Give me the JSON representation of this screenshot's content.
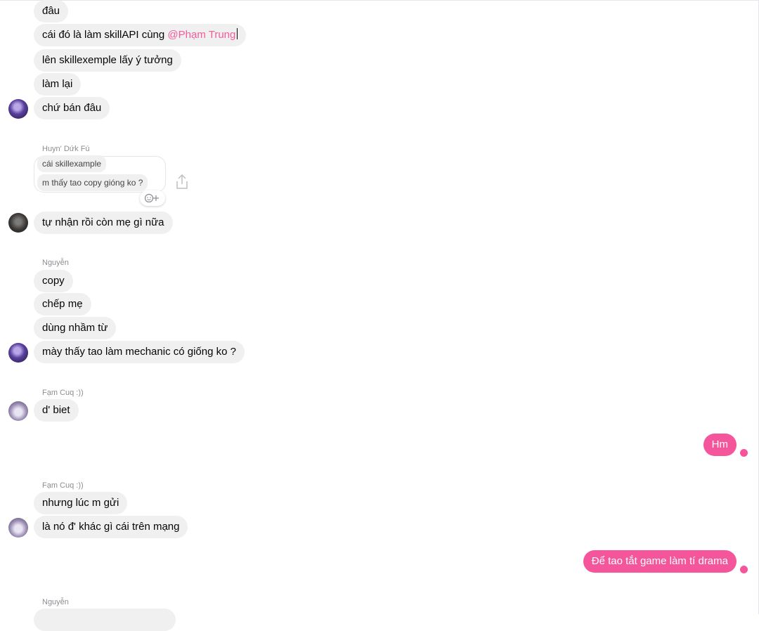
{
  "colors": {
    "accent": "#f5559a",
    "bubble_in": "#f0f0f0",
    "sender_text": "#8a8d91"
  },
  "messages": {
    "m1": "đâu",
    "m2_prefix": "cái đó là làm skillAPI cùng ",
    "m2_mention": "@Phạm Trung",
    "m3": "lên skillexemple lấy ý tưởng",
    "m4": "làm lại",
    "m5": "chứ bán đâu",
    "reply_sender": "Huyn' Dứk Fú",
    "reply_line1": "cái skillexample",
    "reply_line2": "m thấy tao copy  gióng ko ?",
    "m6": "tự nhận rồi còn mẹ gì nữa",
    "sender_nguyen_1": "Nguyễn",
    "m7": "copy",
    "m8": "chếp mẹ",
    "m9": "dùng nhầm từ",
    "m10": "mày thấy tao làm mechanic có giống ko ?",
    "sender_fam_1": "Fạm Cuq :))",
    "m11": "d' biet",
    "out1": "Hm",
    "sender_fam_2": "Fạm Cuq :))",
    "m12": "nhưng lúc m gửi",
    "m13": "là nó đ' khác gì cái trên mạng",
    "out2": "Để tao tắt game làm tí drama",
    "sender_nguyen_2": "Nguyễn"
  },
  "icons": {
    "react": "smiley-plus-icon",
    "share": "share-icon",
    "seen": "check-circle-icon"
  }
}
